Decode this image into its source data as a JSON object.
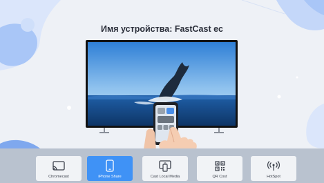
{
  "screen": {
    "title": "Имя устройства:  FastCast ec"
  },
  "menu": {
    "items": [
      {
        "label": "Chromecast",
        "icon": "cast-icon"
      },
      {
        "label": "iPhone Share",
        "icon": "phone-icon"
      },
      {
        "label": "Cast Local Media",
        "icon": "local-media-icon"
      },
      {
        "label": "QR Cost",
        "icon": "qr-code-icon"
      },
      {
        "label": "HotSpot",
        "icon": "hotspot-icon"
      }
    ],
    "selected": "iPhone Share"
  },
  "colors": {
    "accent": "#3f92f6",
    "background": "#eef1f6",
    "bar": "#b9c2cf",
    "blob": "#a9c6f7"
  }
}
